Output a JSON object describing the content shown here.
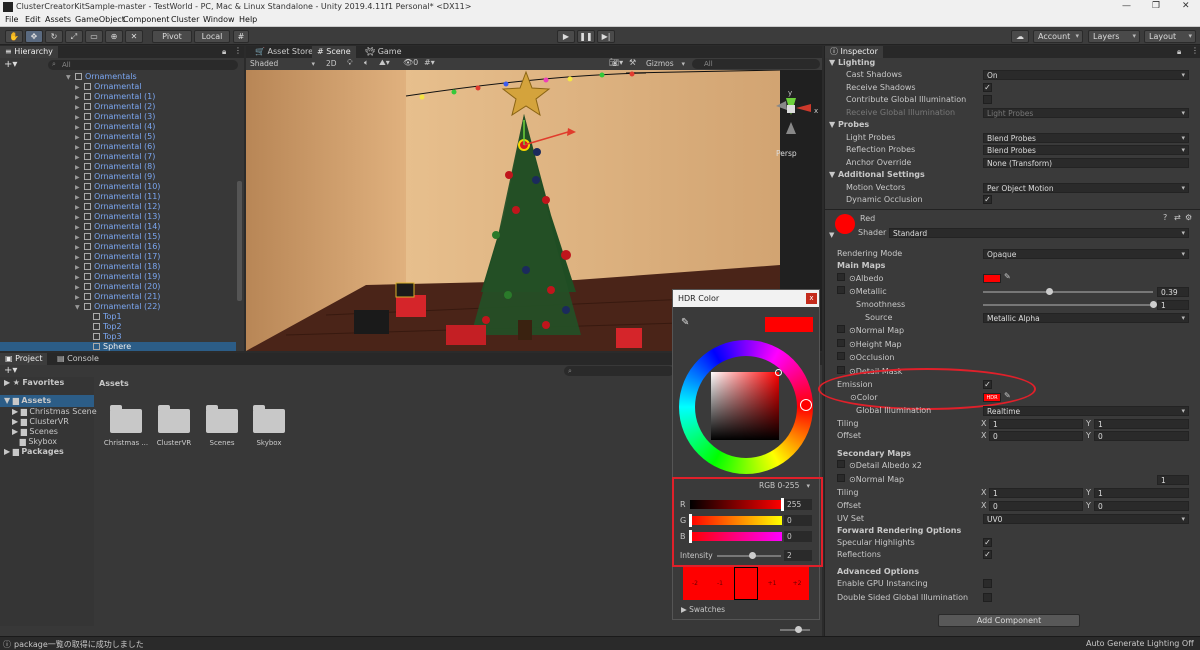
{
  "window": {
    "title": "ClusterCreatorKitSample-master - TestWorld - PC, Mac & Linux Standalone - Unity 2019.4.11f1 Personal* <DX11>"
  },
  "menu": [
    "File",
    "Edit",
    "Assets",
    "GameObject",
    "Component",
    "Cluster",
    "Window",
    "Help"
  ],
  "toolbar": {
    "pivot": "Pivot",
    "local": "Local",
    "account": "Account",
    "layers": "Layers",
    "layout": "Layout"
  },
  "hierarchy": {
    "tab": "Hierarchy",
    "search": "All",
    "items": [
      {
        "label": "Ornamentals",
        "indent": 0,
        "arrow": "▼"
      },
      {
        "label": "Ornamental",
        "indent": 1,
        "arrow": "▶"
      },
      {
        "label": "Ornamental (1)",
        "indent": 1,
        "arrow": "▶"
      },
      {
        "label": "Ornamental (2)",
        "indent": 1,
        "arrow": "▶"
      },
      {
        "label": "Ornamental (3)",
        "indent": 1,
        "arrow": "▶"
      },
      {
        "label": "Ornamental (4)",
        "indent": 1,
        "arrow": "▶"
      },
      {
        "label": "Ornamental (5)",
        "indent": 1,
        "arrow": "▶"
      },
      {
        "label": "Ornamental (6)",
        "indent": 1,
        "arrow": "▶"
      },
      {
        "label": "Ornamental (7)",
        "indent": 1,
        "arrow": "▶"
      },
      {
        "label": "Ornamental (8)",
        "indent": 1,
        "arrow": "▶"
      },
      {
        "label": "Ornamental (9)",
        "indent": 1,
        "arrow": "▶"
      },
      {
        "label": "Ornamental (10)",
        "indent": 1,
        "arrow": "▶"
      },
      {
        "label": "Ornamental (11)",
        "indent": 1,
        "arrow": "▶"
      },
      {
        "label": "Ornamental (12)",
        "indent": 1,
        "arrow": "▶"
      },
      {
        "label": "Ornamental (13)",
        "indent": 1,
        "arrow": "▶"
      },
      {
        "label": "Ornamental (14)",
        "indent": 1,
        "arrow": "▶"
      },
      {
        "label": "Ornamental (15)",
        "indent": 1,
        "arrow": "▶"
      },
      {
        "label": "Ornamental (16)",
        "indent": 1,
        "arrow": "▶"
      },
      {
        "label": "Ornamental (17)",
        "indent": 1,
        "arrow": "▶"
      },
      {
        "label": "Ornamental (18)",
        "indent": 1,
        "arrow": "▶"
      },
      {
        "label": "Ornamental (19)",
        "indent": 1,
        "arrow": "▶"
      },
      {
        "label": "Ornamental (20)",
        "indent": 1,
        "arrow": "▶"
      },
      {
        "label": "Ornamental (21)",
        "indent": 1,
        "arrow": "▶"
      },
      {
        "label": "Ornamental (22)",
        "indent": 1,
        "arrow": "▼"
      },
      {
        "label": "Top1",
        "indent": 2,
        "arrow": ""
      },
      {
        "label": "Top2",
        "indent": 2,
        "arrow": ""
      },
      {
        "label": "Top3",
        "indent": 2,
        "arrow": ""
      },
      {
        "label": "Sphere",
        "indent": 2,
        "arrow": "",
        "selected": true
      }
    ]
  },
  "scene": {
    "tabs": [
      "Asset Store",
      "Scene",
      "Game"
    ],
    "shading": "Shaded",
    "mode2d": "2D",
    "gizmos": "Gizmos",
    "search": "All",
    "persp": "Persp",
    "hidden_count": "0"
  },
  "project": {
    "tabs": [
      "Project",
      "Console"
    ],
    "favorites": "Favorites",
    "assets_root": "Assets",
    "tree": [
      "Christmas Scene",
      "ClusterVR",
      "Scenes",
      "Skybox"
    ],
    "packages": "Packages",
    "breadcrumb": "Assets",
    "folders": [
      "Christmas ...",
      "ClusterVR",
      "Scenes",
      "Skybox"
    ]
  },
  "hdr": {
    "title": "HDR Color",
    "mode": "RGB 0-255",
    "r_label": "R",
    "g_label": "G",
    "b_label": "B",
    "r": "255",
    "g": "0",
    "b": "0",
    "r_level": 1.0,
    "g_level": 0.0,
    "b_level": 0.0,
    "intensity_label": "Intensity",
    "intensity": "2",
    "intensity_level": 0.55,
    "swatches": "Swatches",
    "exposure": [
      "-2",
      "-1",
      "",
      "+1",
      "+2"
    ],
    "color": "#ff0000"
  },
  "inspector": {
    "tab": "Inspector",
    "lighting": "Lighting",
    "rows1": [
      {
        "label": "Cast Shadows",
        "value": "On"
      },
      {
        "label": "Receive Shadows",
        "check": true
      },
      {
        "label": "Contribute Global Illumination",
        "check": false
      },
      {
        "label": "Receive Global Illumination",
        "value": "Light Probes",
        "dim": true
      }
    ],
    "probes": "Probes",
    "rows2": [
      {
        "label": "Light Probes",
        "value": "Blend Probes"
      },
      {
        "label": "Reflection Probes",
        "value": "Blend Probes"
      },
      {
        "label": "Anchor Override",
        "value": "None (Transform)"
      }
    ],
    "additional": "Additional Settings",
    "rows3": [
      {
        "label": "Motion Vectors",
        "value": "Per Object Motion"
      },
      {
        "label": "Dynamic Occlusion",
        "check": true
      }
    ],
    "material_name": "Red",
    "shader_label": "Shader",
    "shader": "Standard",
    "rendering_mode_label": "Rendering Mode",
    "rendering_mode": "Opaque",
    "main_maps": "Main Maps",
    "albedo": "Albedo",
    "metallic": "Metallic",
    "metallic_value": "0.39",
    "metallic_level": 0.39,
    "smoothness": "Smoothness",
    "smoothness_value": "1",
    "smoothness_level": 1.0,
    "source": "Source",
    "source_value": "Metallic Alpha",
    "normal_map": "Normal Map",
    "height_map": "Height Map",
    "occlusion": "Occlusion",
    "detail_mask": "Detail Mask",
    "emission": "Emission",
    "emission_color": "Color",
    "hdr_badge": "HDR",
    "global_illumination": "Global Illumination",
    "gi_value": "Realtime",
    "tiling": "Tiling",
    "offset": "Offset",
    "tiling_x": "1",
    "tiling_y": "1",
    "offset_x": "0",
    "offset_y": "0",
    "secondary_maps": "Secondary Maps",
    "detail_albedo": "Detail Albedo x2",
    "normal_map2": "Normal Map",
    "normal_map2_value": "1",
    "tiling2_x": "1",
    "tiling2_y": "1",
    "offset2_x": "0",
    "offset2_y": "0",
    "uv_set": "UV Set",
    "uv_value": "UV0",
    "forward": "Forward Rendering Options",
    "specular": "Specular Highlights",
    "reflections": "Reflections",
    "advanced": "Advanced Options",
    "gpu_instancing": "Enable GPU Instancing",
    "double_sided": "Double Sided Global Illumination",
    "add_component": "Add Component"
  },
  "status": {
    "message": "package一覧の取得に成功しました",
    "right": "Auto Generate Lighting Off"
  },
  "colors": {
    "accent": "#ff0000",
    "annotation": "#e0202a",
    "selection": "#2c5d87"
  }
}
